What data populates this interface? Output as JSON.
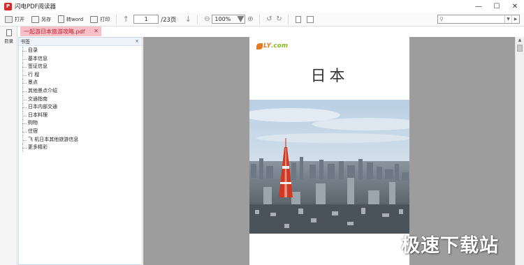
{
  "window": {
    "title": "闪电PDF阅读器",
    "app_icon_glyph": "P",
    "minimize": "—",
    "maximize": "☐",
    "close": "✕"
  },
  "toolbar": {
    "open_label": "打开",
    "saveas_label": "另存",
    "toword_label": "转word",
    "print_label": "打印",
    "page_current": "1",
    "page_total": "/23页",
    "zoom_value": "100%",
    "search_placeholder": ""
  },
  "left_strip": {
    "toc_label": "目录"
  },
  "doc_tab": {
    "filename": "一起游日本旅游攻略.pdf",
    "close": "✕"
  },
  "bookmarks": {
    "title": "书签",
    "close": "×",
    "items": [
      "目录",
      "基本信息",
      "签证信息",
      "行 程",
      "景点",
      "其他景点介绍",
      "交通指南",
      "日本内部交通",
      "日本料理",
      "购物",
      "住宿",
      "飞 机日本其他旅游信息",
      "更多精彩"
    ]
  },
  "document_page": {
    "logo_text_main": "LY",
    "logo_text_sub": ".com",
    "title": "日本"
  },
  "watermark": "极速下载站",
  "colors": {
    "tab_bg": "#f7c0c8",
    "tab_text": "#c0202a",
    "viewer_bg": "#9d9d9d",
    "app_red": "#d62a2a"
  }
}
